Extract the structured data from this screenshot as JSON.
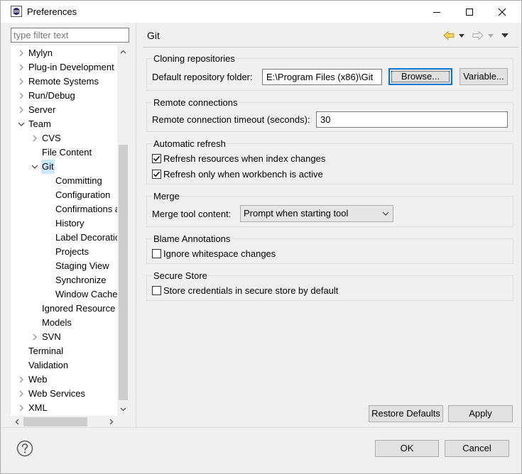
{
  "window": {
    "title": "Preferences",
    "icon": "eclipse-icon"
  },
  "filter": {
    "placeholder": "type filter text",
    "value": ""
  },
  "tree": [
    {
      "label": "Mylyn",
      "level": 0,
      "twisty": "collapsed"
    },
    {
      "label": "Plug-in Development",
      "level": 0,
      "twisty": "collapsed"
    },
    {
      "label": "Remote Systems",
      "level": 0,
      "twisty": "collapsed"
    },
    {
      "label": "Run/Debug",
      "level": 0,
      "twisty": "collapsed"
    },
    {
      "label": "Server",
      "level": 0,
      "twisty": "collapsed"
    },
    {
      "label": "Team",
      "level": 0,
      "twisty": "expanded"
    },
    {
      "label": "CVS",
      "level": 1,
      "twisty": "collapsed"
    },
    {
      "label": "File Content",
      "level": 1,
      "twisty": "none"
    },
    {
      "label": "Git",
      "level": 1,
      "twisty": "expanded",
      "selected": true
    },
    {
      "label": "Committing",
      "level": 2,
      "twisty": "none"
    },
    {
      "label": "Configuration",
      "level": 2,
      "twisty": "none"
    },
    {
      "label": "Confirmations a",
      "level": 2,
      "twisty": "none"
    },
    {
      "label": "History",
      "level": 2,
      "twisty": "none"
    },
    {
      "label": "Label Decoratio",
      "level": 2,
      "twisty": "none"
    },
    {
      "label": "Projects",
      "level": 2,
      "twisty": "none"
    },
    {
      "label": "Staging View",
      "level": 2,
      "twisty": "none"
    },
    {
      "label": "Synchronize",
      "level": 2,
      "twisty": "none"
    },
    {
      "label": "Window Cache",
      "level": 2,
      "twisty": "none"
    },
    {
      "label": "Ignored Resource",
      "level": 1,
      "twisty": "none"
    },
    {
      "label": "Models",
      "level": 1,
      "twisty": "none"
    },
    {
      "label": "SVN",
      "level": 1,
      "twisty": "collapsed"
    },
    {
      "label": "Terminal",
      "level": 0,
      "twisty": "none"
    },
    {
      "label": "Validation",
      "level": 0,
      "twisty": "none"
    },
    {
      "label": "Web",
      "level": 0,
      "twisty": "collapsed"
    },
    {
      "label": "Web Services",
      "level": 0,
      "twisty": "collapsed"
    },
    {
      "label": "XML",
      "level": 0,
      "twisty": "collapsed"
    }
  ],
  "page": {
    "title": "Git",
    "nav_icons": [
      "back-arrow-icon",
      "back-dropdown-icon",
      "forward-arrow-icon",
      "forward-dropdown-icon",
      "view-menu-icon"
    ]
  },
  "cloning": {
    "title": "Cloning repositories",
    "folder_label": "Default repository folder:",
    "folder_value": "E:\\Program Files (x86)\\Git",
    "browse_label": "Browse...",
    "variable_label": "Variable..."
  },
  "remote": {
    "title": "Remote connections",
    "timeout_label": "Remote connection timeout (seconds):",
    "timeout_value": "30"
  },
  "refresh": {
    "title": "Automatic refresh",
    "opt1_label": "Refresh resources when index changes",
    "opt1_checked": true,
    "opt2_label": "Refresh only when workbench is active",
    "opt2_checked": true
  },
  "merge": {
    "title": "Merge",
    "tool_label": "Merge tool content:",
    "tool_value": "Prompt when starting tool"
  },
  "blame": {
    "title": "Blame Annotations",
    "opt_label": "Ignore whitespace changes",
    "opt_checked": false
  },
  "secure": {
    "title": "Secure Store",
    "opt_label": "Store credentials in secure store by default",
    "opt_checked": false
  },
  "buttons": {
    "restore": "Restore Defaults",
    "apply": "Apply",
    "ok": "OK",
    "cancel": "Cancel"
  },
  "colors": {
    "selection": "#cce8ff",
    "focus_border": "#0078d7",
    "window_bg": "#f0f0f0"
  }
}
